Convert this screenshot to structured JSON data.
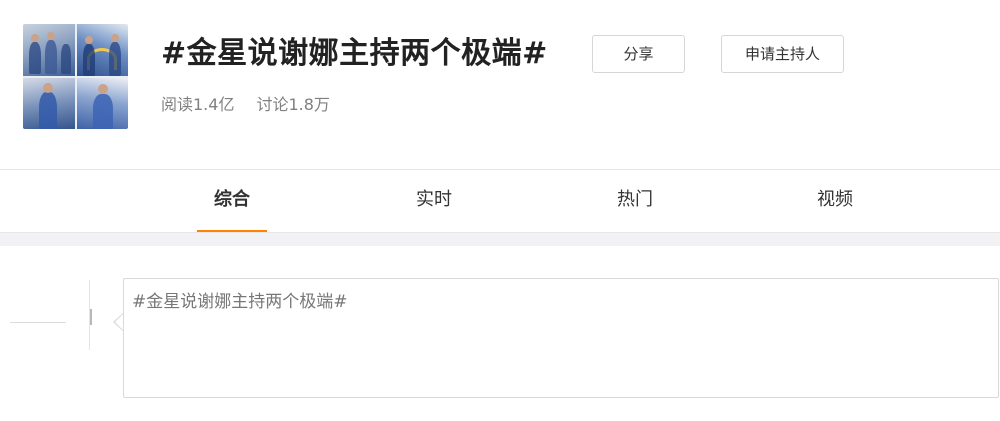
{
  "topic": {
    "title": "#金星说谢娜主持两个极端#",
    "stats": {
      "reads": "阅读1.4亿",
      "discussions": "讨论1.8万"
    }
  },
  "actions": {
    "share_label": "分享",
    "apply_host_label": "申请主持人"
  },
  "tabs": [
    {
      "label": "综合",
      "active": true
    },
    {
      "label": "实时",
      "active": false
    },
    {
      "label": "热门",
      "active": false
    },
    {
      "label": "视频",
      "active": false
    }
  ],
  "compose": {
    "text": "#金星说谢娜主持两个极端#"
  },
  "colors": {
    "accent": "#ff8200",
    "title": "#222222",
    "muted": "#808080"
  },
  "icons": {
    "cover": "topic-cover-collage"
  }
}
